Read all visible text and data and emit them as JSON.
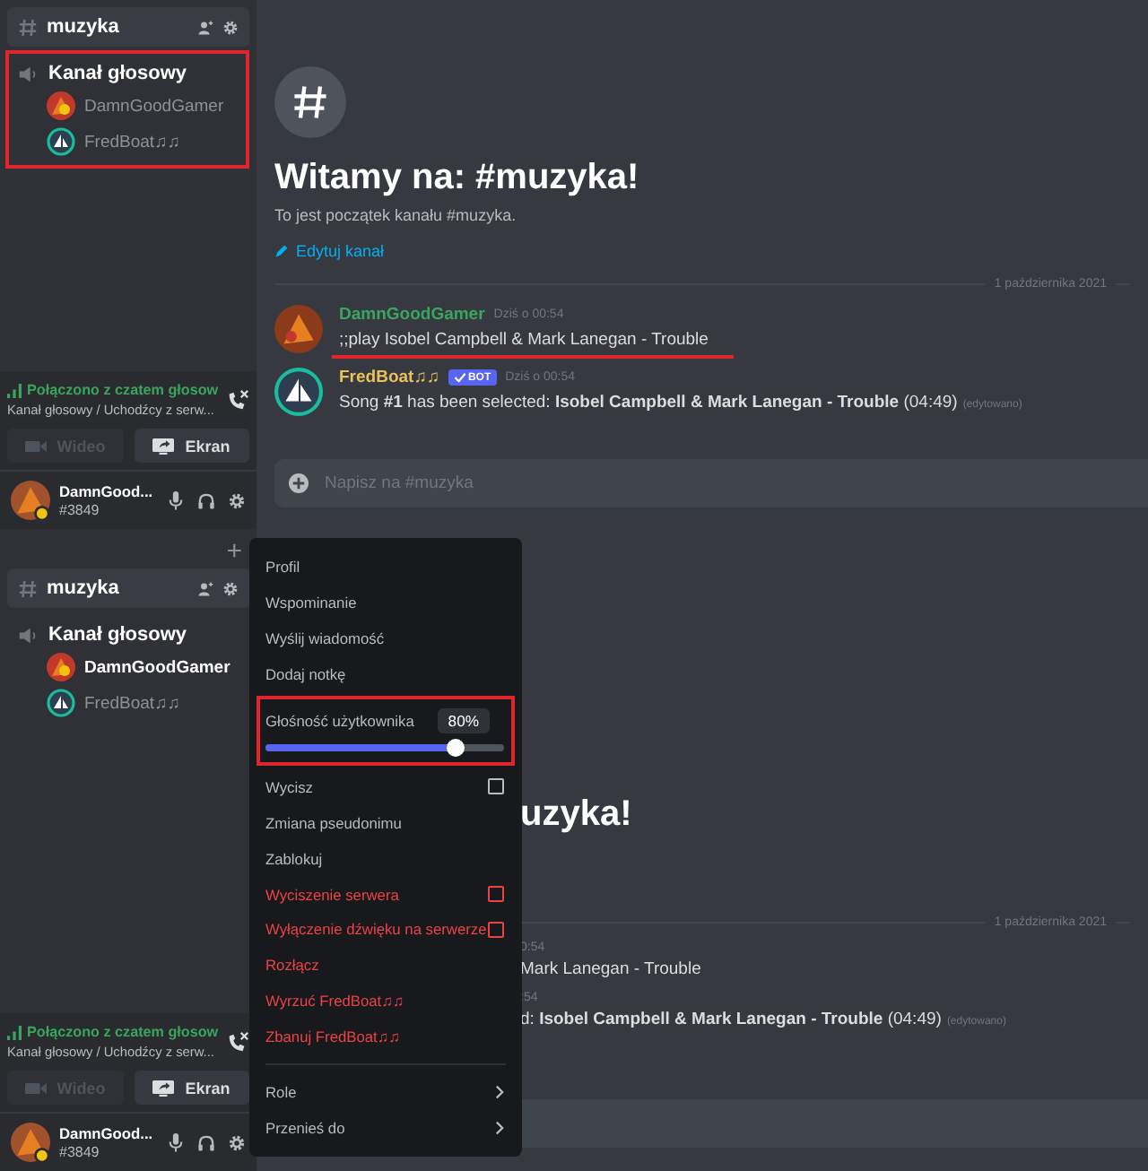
{
  "screens": [
    {
      "sidebar": {
        "channel": {
          "name": "muzyka",
          "selected": true
        },
        "voice_channel": {
          "name": "Kanał głosowy",
          "highlighted": true,
          "users": [
            {
              "name": "DamnGoodGamer",
              "kind": "person",
              "speaking": false
            },
            {
              "name": "FredBoat♫♫",
              "kind": "bot",
              "speaking": false
            }
          ]
        },
        "voice_status": {
          "title": "Połączono z czatem głosow",
          "subtitle": "Kanał głosowy / Uchodźcy z serw..."
        },
        "buttons": [
          {
            "label": "Wideo",
            "kind": "video",
            "active": false
          },
          {
            "label": "Ekran",
            "kind": "screen",
            "active": true
          }
        ],
        "user": {
          "name": "DamnGood...",
          "tag": "#3849"
        }
      },
      "main": {
        "title": "Witamy na: #muzyka!",
        "subtitle": "To jest początek kanału #muzyka.",
        "edit_link": "Edytuj kanał",
        "date": "1 października 2021",
        "messages": [
          {
            "author": "DamnGoodGamer",
            "kind": "person",
            "color": "#3ba55d",
            "time": "Dziś o 00:54",
            "text": ";;play Isobel Campbell & Mark Lanegan - Trouble",
            "highlighted": true
          },
          {
            "author": "FredBoat♫♫",
            "kind": "bot",
            "color": "#e8c15a",
            "badge": "BOT",
            "time": "Dziś o 00:54",
            "text": "Song **#1** has been selected: **Isobel Campbell & Mark Lanegan - Trouble** (04:49)",
            "edited": "(edytowano)"
          }
        ],
        "placeholder": "Napisz na #muzyka"
      }
    },
    {
      "sidebar": {
        "add_button": "+",
        "channel": {
          "name": "muzyka",
          "selected": true
        },
        "voice_channel": {
          "name": "Kanał głosowy",
          "users": [
            {
              "name": "DamnGoodGamer",
              "kind": "person",
              "speaking": true
            },
            {
              "name": "FredBoat♫♫",
              "kind": "bot",
              "speaking": false
            }
          ]
        },
        "voice_status": {
          "title": "Połączono z czatem głosow",
          "subtitle": "Kanał głosowy / Uchodźcy z serw..."
        },
        "buttons": [
          {
            "label": "Wideo",
            "kind": "video",
            "active": false
          },
          {
            "label": "Ekran",
            "kind": "screen",
            "active": true
          }
        ],
        "user": {
          "name": "DamnGood...",
          "tag": "#3849"
        }
      },
      "partial_main": {
        "title": "uzyka!",
        "date": "1 października 2021",
        "messages": [
          {
            "time": "0:54",
            "text": "Mark Lanegan - Trouble"
          },
          {
            "time": ":54",
            "text": "d: **Isobel Campbell & Mark Lanegan - Trouble** (04:49)",
            "edited": "(edytowano)"
          }
        ]
      },
      "context_menu": {
        "items": [
          {
            "kind": "action",
            "label": "Profil",
            "danger": false
          },
          {
            "kind": "action",
            "label": "Wspominanie",
            "danger": false
          },
          {
            "kind": "action",
            "label": "Wyślij wiadomość",
            "danger": false
          },
          {
            "kind": "action",
            "label": "Dodaj notkę",
            "danger": false
          },
          {
            "kind": "slider",
            "label": "Głośność użytkownika",
            "value_label": "80%",
            "level": 0.8,
            "highlighted": true
          },
          {
            "kind": "checkbox",
            "label": "Wycisz",
            "danger": false,
            "checked": false
          },
          {
            "kind": "action",
            "label": "Zmiana pseudonimu",
            "danger": false
          },
          {
            "kind": "action",
            "label": "Zablokuj",
            "danger": false
          },
          {
            "kind": "checkbox",
            "label": "Wyciszenie serwera",
            "danger": true,
            "checked": false
          },
          {
            "kind": "checkbox",
            "label": "Wyłączenie dźwięku na serwerze",
            "danger": true,
            "checked": false
          },
          {
            "kind": "action",
            "label": "Rozłącz",
            "danger": true
          },
          {
            "kind": "action",
            "label": "Wyrzuć FredBoat♫♫",
            "danger": true
          },
          {
            "kind": "action",
            "label": "Zbanuj FredBoat♫♫",
            "danger": true
          },
          {
            "kind": "submenu",
            "label": "Role",
            "danger": false
          },
          {
            "kind": "submenu",
            "label": "Przenieś do",
            "danger": false
          }
        ]
      }
    }
  ]
}
